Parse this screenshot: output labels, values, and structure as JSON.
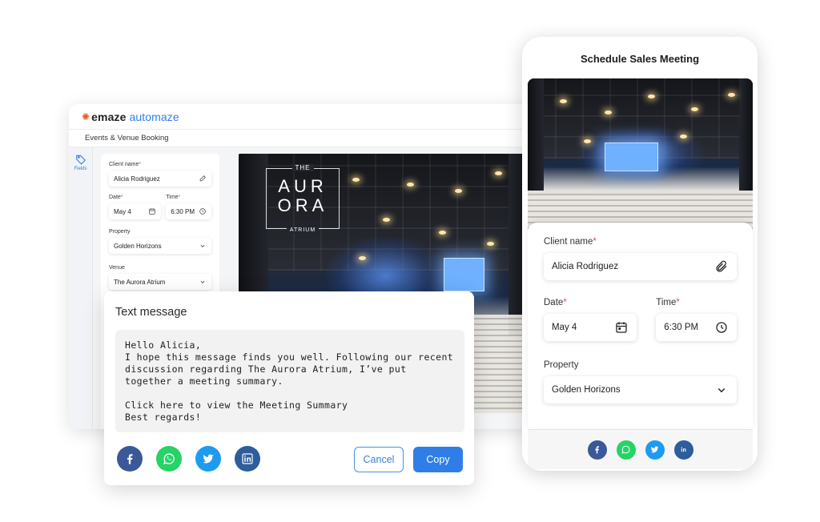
{
  "app": {
    "brand": "emaze",
    "product": "automaze",
    "subtitle": "Events & Venue Booking",
    "rail_label": "Fields"
  },
  "form": {
    "client_label": "Client name",
    "client_value": "Alicia Rodriguez",
    "date_label": "Date",
    "date_value": "May 4",
    "time_label": "Time",
    "time_value": "6:30 PM",
    "property_label": "Property",
    "property_value": "Golden Horizons",
    "venue_label": "Venue",
    "venue_value": "The Aurora Atrium",
    "required_mark": "*"
  },
  "venue_logo": {
    "the": "THE",
    "line1": "AUR",
    "line2": "ORA",
    "atrium": "ATRIUM"
  },
  "message": {
    "title": "Text message",
    "greeting": "Hello Alicia,",
    "line1": "I hope this message finds you well. Following our recent",
    "line2": "discussion regarding The Aurora Atrium, I’ve put",
    "line3": "together a meeting summary.",
    "line4": "Click here to view the Meeting Summary",
    "line5": "Best regards!",
    "cancel_label": "Cancel",
    "copy_label": "Copy"
  },
  "phone": {
    "title": "Schedule Sales Meeting"
  },
  "share_icons": [
    "facebook-icon",
    "whatsapp-icon",
    "twitter-icon",
    "linkedin-icon"
  ],
  "colors": {
    "accent": "#2f7ee8",
    "facebook": "#3b5998",
    "whatsapp": "#25d366",
    "twitter": "#1d9bf0",
    "linkedin": "#2d5d9b",
    "required": "#e04848"
  }
}
